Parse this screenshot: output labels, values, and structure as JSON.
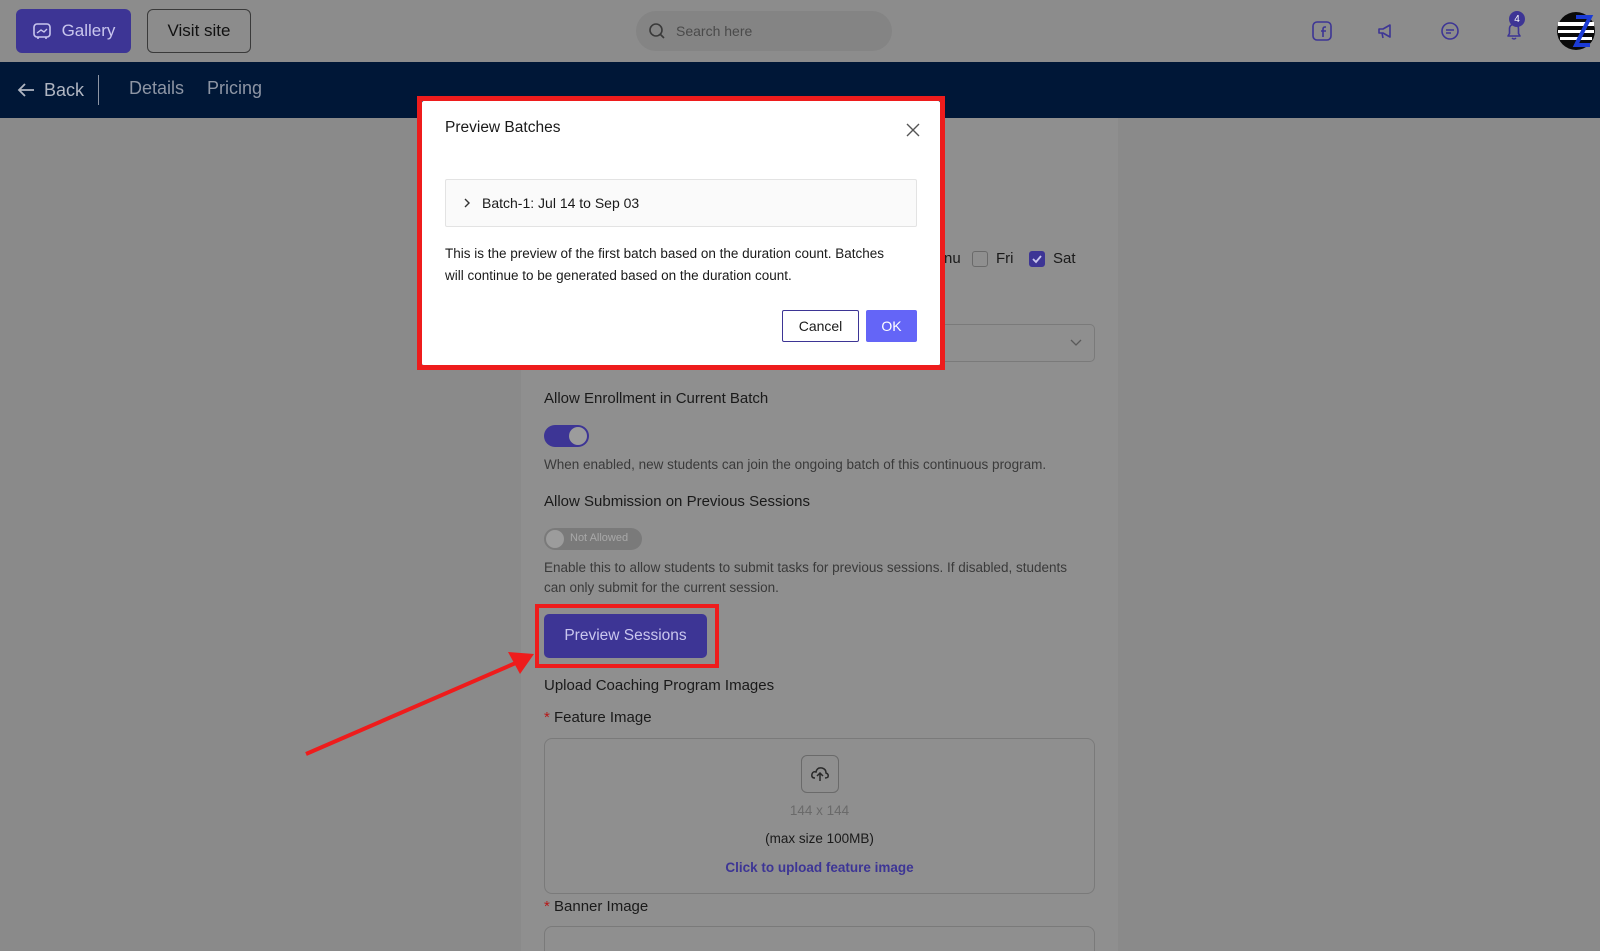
{
  "topbar": {
    "gallery_label": "Gallery",
    "visit_label": "Visit site",
    "search_placeholder": "Search here",
    "notification_count": "4"
  },
  "nav": {
    "back_label": "Back",
    "tabs": [
      "Details",
      "Pricing"
    ]
  },
  "form": {
    "days": [
      {
        "label": "nu",
        "checked": false
      },
      {
        "label": "Fri",
        "checked": false
      },
      {
        "label": "Sat",
        "checked": true
      }
    ],
    "allow_enrollment_label": "Allow Enrollment in Current Batch",
    "allow_enrollment_on": true,
    "allow_enrollment_hint": "When enabled, new students can join the ongoing batch of this continuous program.",
    "allow_submission_label": "Allow Submission on Previous Sessions",
    "allow_submission_toggle_text": "Not Allowed",
    "allow_submission_hint_1": "Enable this to allow students to submit tasks for previous sessions. If disabled, students",
    "allow_submission_hint_2": "can only submit for the current session.",
    "preview_button": "Preview Sessions",
    "upload_heading": "Upload Coaching Program Images",
    "feature_label": "Feature Image",
    "feature_size": "144 x 144",
    "feature_max": "(max size 100MB)",
    "feature_link": "Click to upload feature image",
    "banner_label": "Banner Image",
    "required_mark": "*"
  },
  "modal": {
    "title": "Preview Batches",
    "batch_label": "Batch-1: Jul 14 to Sep 03",
    "text_line_1": "This is the preview of the first batch based on the duration count. Batches",
    "text_line_2": "will continue to be generated based on the duration count.",
    "cancel_label": "Cancel",
    "ok_label": "OK"
  },
  "colors": {
    "primary": "#3d3595",
    "ok_button": "#6465f7",
    "nav_bg": "#001737",
    "highlight": "#ee1c1c"
  }
}
